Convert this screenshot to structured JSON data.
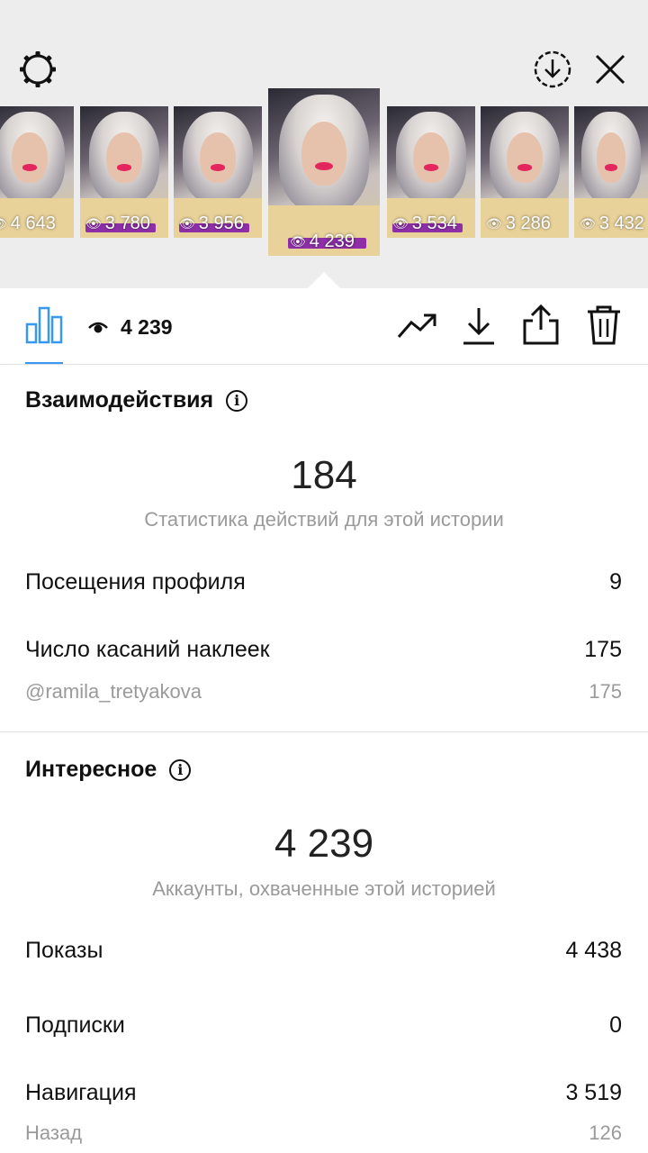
{
  "stories": [
    {
      "views": "4 643"
    },
    {
      "views": "3 780"
    },
    {
      "views": "3 956"
    },
    {
      "views": "4 239",
      "selected": true
    },
    {
      "views": "3 534"
    },
    {
      "views": "3 286"
    },
    {
      "views": "3 432"
    }
  ],
  "story_tag": "@ramila_tretyakova",
  "toolbar": {
    "views_count": "4 239"
  },
  "interactions": {
    "title": "Взаимодействия",
    "total": "184",
    "caption": "Статистика действий для этой истории",
    "rows": [
      {
        "label": "Посещения профиля",
        "value": "9"
      },
      {
        "label": "Число касаний наклеек",
        "value": "175"
      }
    ],
    "sub_row": {
      "label": "@ramila_tretyakova",
      "value": "175"
    }
  },
  "discovery": {
    "title": "Интересное",
    "total": "4 239",
    "caption": "Аккаунты, охваченные этой историей",
    "rows": [
      {
        "label": "Показы",
        "value": "4 438"
      },
      {
        "label": "Подписки",
        "value": "0"
      },
      {
        "label": "Навигация",
        "value": "3 519"
      }
    ],
    "sub_row": {
      "label": "Назад",
      "value": "126"
    }
  },
  "colors": {
    "accent": "#3897f0",
    "tag": "#8e2fa8",
    "secondary_text": "#9a9a9a"
  },
  "icons": [
    "settings-gear-icon",
    "download-circle-icon",
    "close-icon",
    "bar-chart-icon",
    "eye-icon",
    "trending-icon",
    "download-icon",
    "share-icon",
    "trash-icon",
    "info-icon"
  ]
}
